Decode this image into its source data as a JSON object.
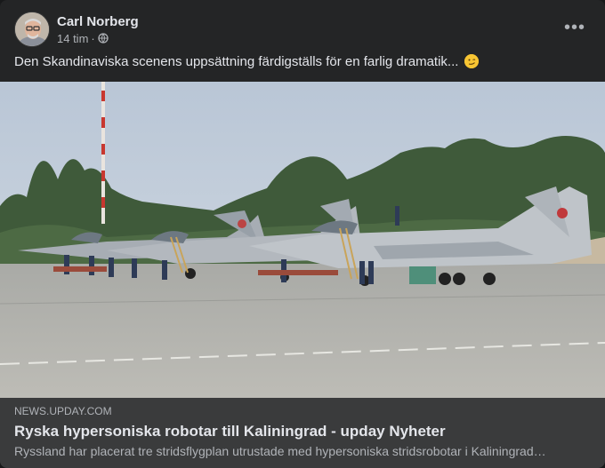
{
  "post": {
    "author": "Carl Norberg",
    "time": "14 tim",
    "separator": "·",
    "audience_icon": "globe-icon",
    "text": "Den Skandinaviska scenens uppsättning färdigställs för en farlig dramatik...",
    "emoji": "smirk-emoji",
    "more_icon": "more-options-icon",
    "more_label": "•••"
  },
  "image": {
    "description_icon": "military-jets-photo"
  },
  "link_preview": {
    "domain": "NEWS.UPDAY.COM",
    "title": "Ryska hypersoniska robotar till Kaliningrad - upday Nyheter",
    "description": "Ryssland har placerat tre stridsflygplan utrustade med hypersoniska stridsrobotar i Kaliningrad…"
  },
  "colors": {
    "card_bg": "#242526",
    "link_bg": "#3a3b3c",
    "text_primary": "#e4e6eb",
    "text_secondary": "#b0b3b8"
  }
}
